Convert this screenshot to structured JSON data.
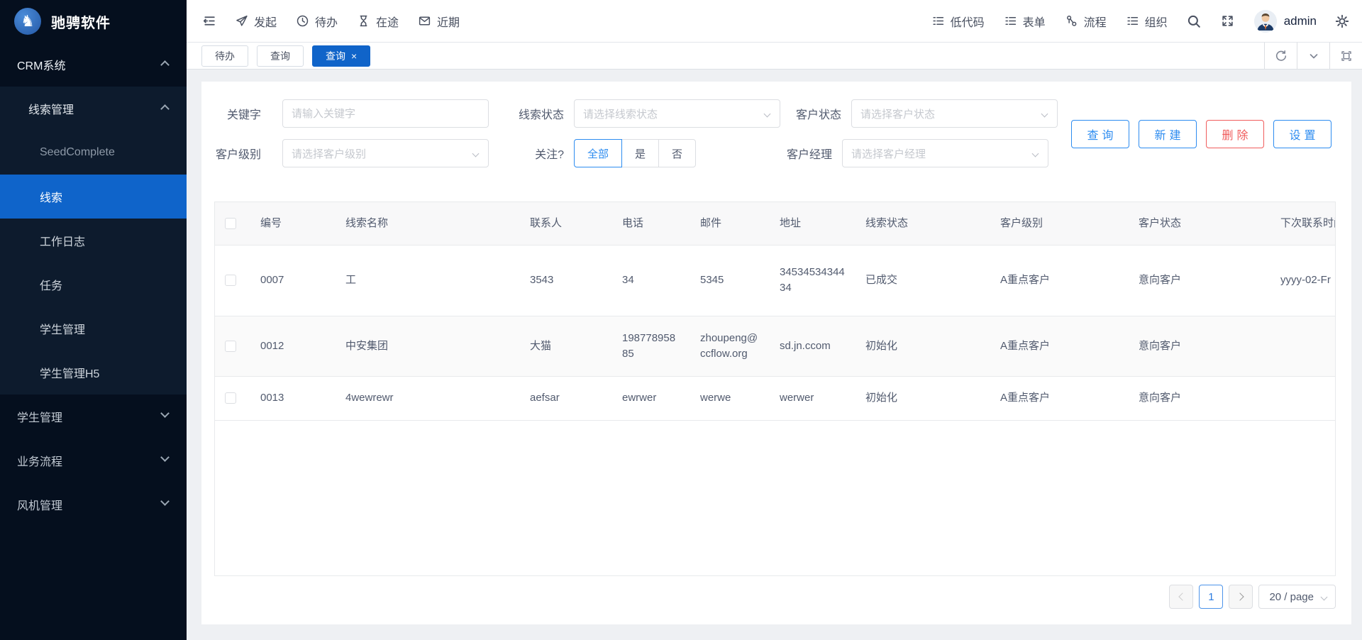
{
  "brand": {
    "name": "驰骋软件",
    "logo_glyph": "♞"
  },
  "topbar": {
    "menus_left": [
      {
        "label": "发起"
      },
      {
        "label": "待办"
      },
      {
        "label": "在途"
      },
      {
        "label": "近期"
      }
    ],
    "menus_right": [
      {
        "label": "低代码"
      },
      {
        "label": "表单"
      },
      {
        "label": "流程"
      },
      {
        "label": "组织"
      }
    ],
    "username": "admin"
  },
  "sidebar": {
    "items": [
      {
        "label": "CRM系统",
        "level": 1,
        "state": "expanded"
      },
      {
        "label": "线索管理",
        "level": 2,
        "state": "expanded"
      },
      {
        "label": "SeedComplete",
        "level": 3
      },
      {
        "label": "线索",
        "level": 3,
        "selected": true
      },
      {
        "label": "工作日志",
        "level": 3
      },
      {
        "label": "任务",
        "level": 3
      },
      {
        "label": "学生管理",
        "level": 3
      },
      {
        "label": "学生管理H5",
        "level": 3
      },
      {
        "label": "学生管理",
        "level": 1,
        "state": "collapsed"
      },
      {
        "label": "业务流程",
        "level": 1,
        "state": "collapsed"
      },
      {
        "label": "风机管理",
        "level": 1,
        "state": "collapsed"
      }
    ]
  },
  "tabs": [
    {
      "label": "待办"
    },
    {
      "label": "查询"
    },
    {
      "label": "查询",
      "active": true,
      "close": "×"
    }
  ],
  "filters": {
    "keyword": {
      "label": "关键字",
      "placeholder": "请输入关键字",
      "value": ""
    },
    "lead_status": {
      "label": "线索状态",
      "placeholder": "请选择线索状态"
    },
    "customer_status": {
      "label": "客户状态",
      "placeholder": "请选择客户状态"
    },
    "customer_level": {
      "label": "客户级别",
      "placeholder": "请选择客户级别"
    },
    "follow": {
      "label": "关注?",
      "options": [
        "全部",
        "是",
        "否"
      ],
      "selected": "全部"
    },
    "customer_manager": {
      "label": "客户经理",
      "placeholder": "请选择客户经理"
    }
  },
  "actions": {
    "query": "查询",
    "create": "新建",
    "delete": "删除",
    "settings": "设置"
  },
  "table": {
    "columns": [
      "编号",
      "线索名称",
      "联系人",
      "电话",
      "邮件",
      "地址",
      "线索状态",
      "客户级别",
      "客户状态",
      "下次联系时间"
    ],
    "rows": [
      {
        "id": "0007",
        "name": "工",
        "contact": "3543",
        "phone": "34",
        "email": "5345",
        "address": "3453453434434",
        "lead_status": "已成交",
        "level": "A重点客户",
        "status": "意向客户",
        "next_contact": "yyyy-02-Fr"
      },
      {
        "id": "0012",
        "name": "中安集团",
        "contact": "大猫",
        "phone": "19877895885",
        "email": "zhoupeng@ccflow.org",
        "address": "sd.jn.ccom",
        "lead_status": "初始化",
        "level": "A重点客户",
        "status": "意向客户",
        "next_contact": ""
      },
      {
        "id": "0013",
        "name": "4wewrewr",
        "contact": "aefsar",
        "phone": "ewrwer",
        "email": "werwe",
        "address": "werwer",
        "lead_status": "初始化",
        "level": "A重点客户",
        "status": "意向客户",
        "next_contact": ""
      }
    ]
  },
  "pagination": {
    "current_page": "1",
    "page_size_label": "20 / page"
  },
  "colors": {
    "primary": "#1064c9",
    "accent": "#2d8cf0",
    "danger": "#f05c5c",
    "sidebar_bg": "#050f1e",
    "sidebar_submenu_bg": "#0d1b2d",
    "selected_bg": "#0f64ca",
    "content_bg": "#eef0f3",
    "table_border": "#e8eaec"
  }
}
